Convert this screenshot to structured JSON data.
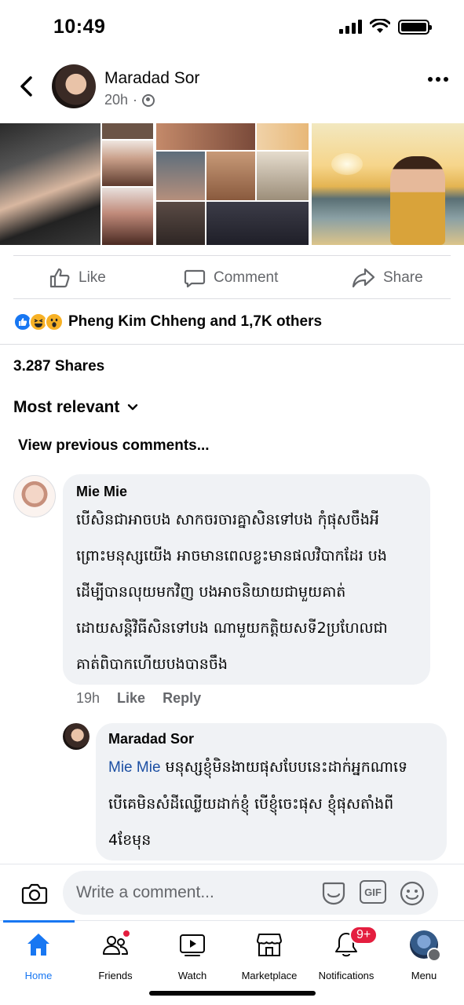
{
  "status_bar": {
    "time": "10:49"
  },
  "post": {
    "author": "Maradad Sor",
    "time_ago": "20h",
    "separator": "·"
  },
  "actions": {
    "like": "Like",
    "comment": "Comment",
    "share": "Share"
  },
  "reactions": {
    "summary": "Pheng Kim Chheng and 1,7K others"
  },
  "shares": {
    "label": "3.287 Shares"
  },
  "sort": {
    "label": "Most relevant"
  },
  "view_previous": {
    "label": "View previous comments..."
  },
  "comments": [
    {
      "author": "Mie Mie",
      "lines": [
        "បើសិនជាអាចបង សាកចរចារគ្នាសិនទៅបង កុំផុសចឹងអី",
        "ព្រោះមនុស្សយើង អាចមានពេលខ្លះមានផលវិបាកដែរ បង",
        "ដើម្បីបានលុយមកវិញ បងអាចនិយាយជាមួយគាត់",
        "ដោយសន្តិវិធីសិនទៅបង ណាមួយកត្តិយសទី2ប្រហែលជា",
        "គាត់ពិបាកហើយបងបានចឹង"
      ],
      "time": "19h",
      "like_label": "Like",
      "reply_label": "Reply"
    },
    {
      "author": "Maradad Sor",
      "mention": "Mie Mie",
      "lines": [
        " មនុស្សខ្ញុំមិនងាយផុសបែបនេះដាក់អ្នកណាទេ",
        "បើគេមិនសំដីឈ្លើយដាក់ខ្ញុំ បើខ្ញុំចេះផុស ខ្ញុំផុសតាំងពី",
        "4ខែមុន"
      ]
    }
  ],
  "composer": {
    "placeholder": "Write a comment...",
    "gif_label": "GIF"
  },
  "tab_bar": {
    "items": [
      {
        "label": "Home"
      },
      {
        "label": "Friends"
      },
      {
        "label": "Watch"
      },
      {
        "label": "Marketplace"
      },
      {
        "label": "Notifications",
        "badge": "9+"
      },
      {
        "label": "Menu"
      }
    ]
  },
  "colors": {
    "accent": "#1877f2",
    "badge": "#e41e3f",
    "secondary_text": "#65676b",
    "bubble": "#f0f2f5"
  }
}
